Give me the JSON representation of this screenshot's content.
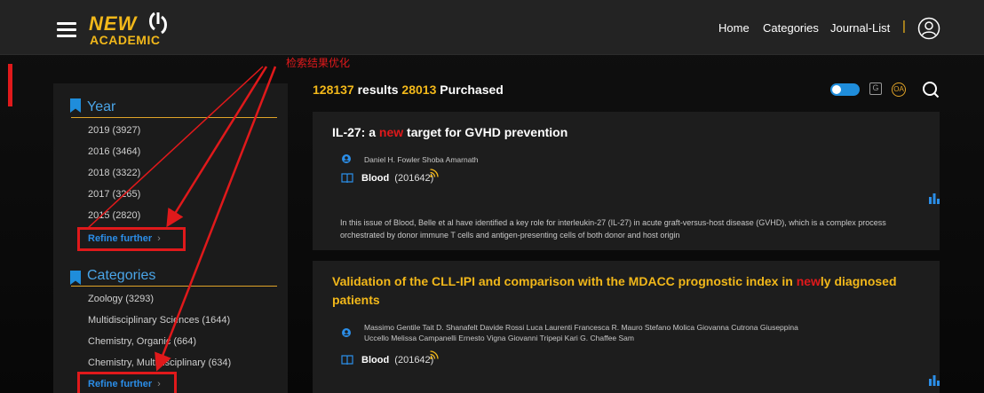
{
  "header": {
    "logo_top": "NEW",
    "logo_bottom": "ACADEMIC",
    "nav": [
      "Home",
      "Categories",
      "Journal-List"
    ],
    "separator": "|"
  },
  "annotation": "检索结果优化",
  "sidebar": {
    "year_title": "Year",
    "years": [
      "2019  (3927)",
      "2016  (3464)",
      "2018  (3322)",
      "2017  (3265)",
      "2015  (2820)"
    ],
    "year_refine": "Refine further",
    "categories_title": "Categories",
    "categories": [
      "Zoology  (3293)",
      "Multidisciplinary Sciences  (1644)",
      "Chemistry, Organic  (664)",
      "Chemistry, Multidisciplinary  (634)"
    ],
    "categories_refine": "Refine further",
    "chevron": "›"
  },
  "results": {
    "count": "128137",
    "count_label": " results  ",
    "purchased": "28013",
    "purchased_label": " Purchased"
  },
  "toolbar": {
    "g_label": "G",
    "oa_label": "OA"
  },
  "articles": [
    {
      "title_before": "IL-27: a ",
      "title_highlight": "new",
      "title_after": " target for GVHD prevention",
      "authors": "Daniel H. Fowler   Shoba Amarnath",
      "journal": "Blood",
      "year": "(201642)",
      "abstract": "In this issue of Blood, Belle et al have identified a key role for interleukin-27 (IL-27) in acute graft-versus-host disease (GVHD), which is a complex process orchestrated by donor immune T cells and antigen-presenting cells of both donor and host origin"
    },
    {
      "title_line1_before": "Validation of the CLL-IPI and comparison with the MDACC prognostic index in ",
      "title_highlight": "new",
      "title_line1_after": "ly diagnosed",
      "title_line2": "patients",
      "authors_line1": "Massimo Gentile   Tait D. Shanafelt   Davide Rossi   Luca Laurenti   Francesca R. Mauro   Stefano Molica   Giovanna Cutrona   Giuseppina",
      "authors_line2": "Uccello   Melissa Campanelli   Ernesto Vigna   Giovanni Tripepi   Kari G. Chaffee   Sam",
      "journal": "Blood",
      "year": "(201642)"
    }
  ],
  "colors": {
    "accent_gold": "#f2b81a",
    "annotation_red": "#e0191b",
    "link_blue": "#2b8ee8",
    "flag_blue": "#1f8ddb"
  },
  "icons": [
    "menu-icon",
    "user-icon",
    "bookmark-icon",
    "toggle-switch",
    "g-icon",
    "oa-icon",
    "search-icon",
    "author-icon",
    "book-icon",
    "rss-icon",
    "bar-chart-icon"
  ]
}
